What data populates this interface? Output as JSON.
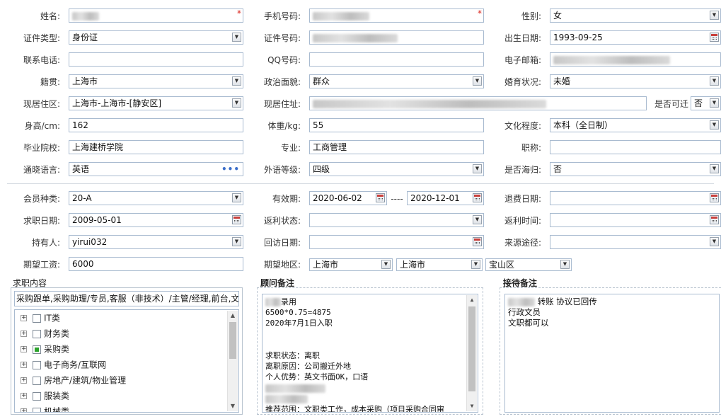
{
  "form": {
    "name": {
      "label": "姓名:",
      "value": ""
    },
    "phone": {
      "label": "手机号码:",
      "value": ""
    },
    "gender": {
      "label": "性别:",
      "value": "女"
    },
    "id_type": {
      "label": "证件类型:",
      "value": "身份证"
    },
    "id_number": {
      "label": "证件号码:",
      "value": ""
    },
    "birthdate": {
      "label": "出生日期:",
      "value": "1993-09-25"
    },
    "contact_phone": {
      "label": "联系电话:",
      "value": ""
    },
    "qq": {
      "label": "QQ号码:",
      "value": ""
    },
    "email": {
      "label": "电子邮箱:",
      "value": ""
    },
    "native_place": {
      "label": "籍贯:",
      "value": "上海市"
    },
    "political": {
      "label": "政治面貌:",
      "value": "群众"
    },
    "marital": {
      "label": "婚育状况:",
      "value": "未婚"
    },
    "current_area": {
      "label": "现居住区:",
      "value": "上海市-上海市-[静安区]"
    },
    "current_address": {
      "label": "现居住址:",
      "value": ""
    },
    "relocatable": {
      "label": "是否可迁",
      "value": "否"
    },
    "height": {
      "label": "身高/cm:",
      "value": "162"
    },
    "weight": {
      "label": "体重/kg:",
      "value": "55"
    },
    "education": {
      "label": "文化程度:",
      "value": "本科（全日制）"
    },
    "school": {
      "label": "毕业院校:",
      "value": "上海建桥学院"
    },
    "major": {
      "label": "专业:",
      "value": "工商管理"
    },
    "title": {
      "label": "职称:",
      "value": ""
    },
    "language": {
      "label": "通晓语言:",
      "value": "英语"
    },
    "language_level": {
      "label": "外语等级:",
      "value": "四级"
    },
    "returnee": {
      "label": "是否海归:",
      "value": "否"
    }
  },
  "membership": {
    "member_type": {
      "label": "会员种类:",
      "value": "20-A"
    },
    "valid_period": {
      "label": "有效期:",
      "start": "2020-06-02",
      "sep": "----",
      "end": "2020-12-01"
    },
    "refund_date": {
      "label": "退费日期:",
      "value": ""
    },
    "job_date": {
      "label": "求职日期:",
      "value": "2009-05-01"
    },
    "rebate_status": {
      "label": "返利状态:",
      "value": ""
    },
    "rebate_time": {
      "label": "返利时间:",
      "value": ""
    },
    "holder": {
      "label": "持有人:",
      "value": "yirui032"
    },
    "visit_date": {
      "label": "回访日期:",
      "value": ""
    },
    "source": {
      "label": "来源途径:",
      "value": ""
    },
    "expected_salary": {
      "label": "期望工资:",
      "value": "6000"
    },
    "expected_area": {
      "label": "期望地区:",
      "province": "上海市",
      "city": "上海市",
      "district": "宝山区"
    }
  },
  "job_content": {
    "title": "求职内容",
    "summary": "采购跟单,采购助理/专员,客服（非技术）/主管/经理,前台,文",
    "tree": [
      {
        "label": "IT类",
        "state": "unchecked"
      },
      {
        "label": "财务类",
        "state": "unchecked"
      },
      {
        "label": "采购类",
        "state": "partial"
      },
      {
        "label": "电子商务/互联网",
        "state": "unchecked"
      },
      {
        "label": "房地产/建筑/物业管理",
        "state": "unchecked"
      },
      {
        "label": "服装类",
        "state": "unchecked"
      },
      {
        "label": "机械类",
        "state": "unchecked"
      }
    ]
  },
  "consultant_notes": {
    "title": "顾问备注",
    "lines": [
      "录用",
      "6500*0.75=4875",
      "2020年7月1日入职",
      "",
      "",
      "求职状态：离职",
      "离职原因：公司搬迁外地",
      "个人优势：英文书面OK，口语",
      "",
      "",
      "推荐范围：文职类工作，成本采购（项目采购合同审"
    ]
  },
  "reception_notes": {
    "title": "接待备注",
    "line1_suffix": "转账  协议已回传",
    "line2": "行政文员",
    "line3": "文职都可以"
  }
}
